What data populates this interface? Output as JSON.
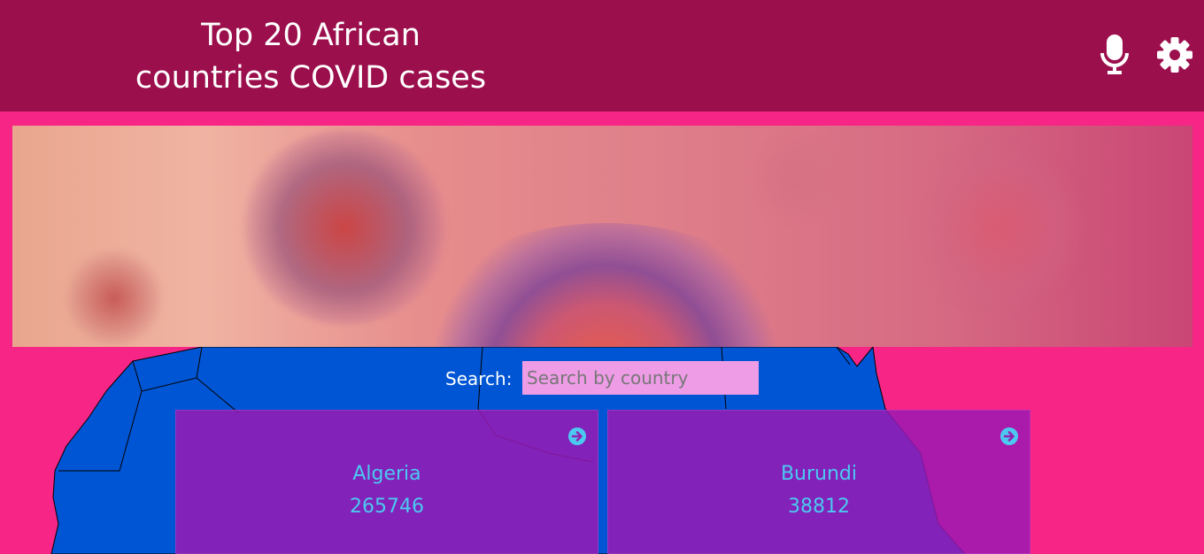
{
  "header": {
    "title_line1": "Top 20 African",
    "title_line2": "countries COVID cases",
    "icons": [
      "microphone-icon",
      "gear-icon"
    ]
  },
  "search": {
    "label": "Search:",
    "placeholder": "Search by country",
    "value": ""
  },
  "cards": [
    {
      "country": "Algeria",
      "cases": "265746"
    },
    {
      "country": "Burundi",
      "cases": "38812"
    }
  ],
  "colors": {
    "header_bg": "#9b0f4d",
    "page_bg": "#f72585",
    "map_fill": "#0055d4",
    "card_bg": "#8f22b0",
    "card_text": "#4cc9f0",
    "search_bg": "#ee9ce6"
  }
}
